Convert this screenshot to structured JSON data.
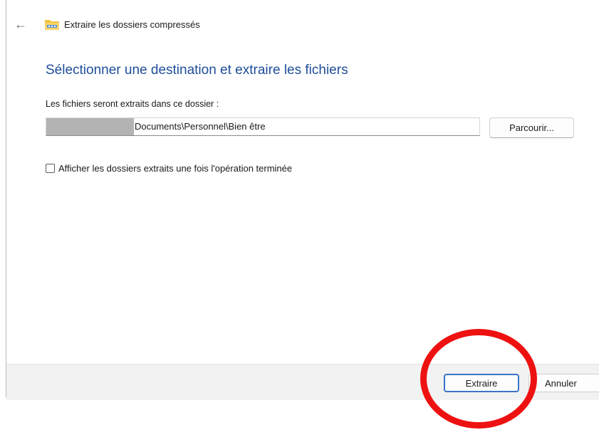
{
  "window": {
    "title": "Extraire les dossiers compressés",
    "back_icon": "back-arrow-icon",
    "app_icon": "zip-folder-icon"
  },
  "main": {
    "heading": "Sélectionner une destination et extraire les fichiers",
    "destination_label": "Les fichiers seront extraits dans ce dossier :",
    "destination_value": "Documents\\Personnel\\Bien être",
    "browse_label": "Parcourir...",
    "show_folders_label": "Afficher les dossiers extraits une fois l'opération terminée",
    "show_folders_checked": false
  },
  "footer": {
    "extract_label": "Extraire",
    "cancel_label": "Annuler"
  },
  "colors": {
    "heading": "#1f4e99",
    "primary_button_border": "#3b73c7",
    "annotation": "#ee1111"
  }
}
